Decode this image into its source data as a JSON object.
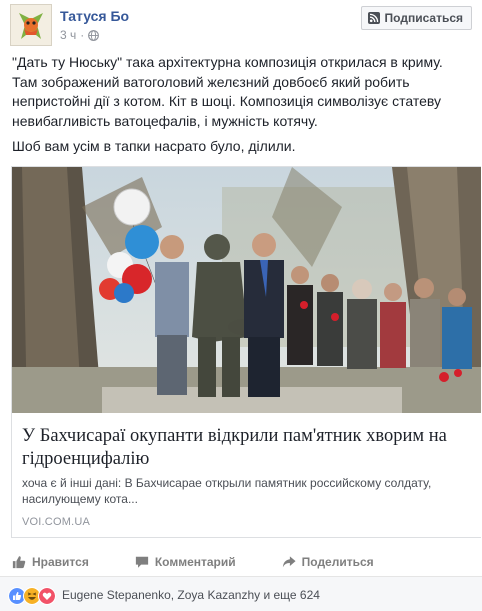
{
  "header": {
    "author_name": "Татуся Бо",
    "timestamp": "3 ч",
    "privacy_icon": "globe-icon",
    "subscribe_label": "Подписаться"
  },
  "post": {
    "paragraph_1": "\"Дать ту Нюську\" така архітектурна композиція открилася в криму. Там зображений ватоголовий желєзний довбоєб який робить непристойні дії з котом. Кіт в шоці. Композиція символізує статеву невибагливість ватоцефалів, і мужність котячу.",
    "paragraph_2": "Шоб вам усім в тапки насрато було, ділили."
  },
  "link_card": {
    "title": "У Бахчисараї окупанти відкрили пам'ятник хворим на гідроенцифалію",
    "description": "хоча є й інші дані: В Бахчисарае открыли памятник российскому солдату, насилующему кота...",
    "domain": "VOI.COM.UA"
  },
  "actions": {
    "like": "Нравится",
    "comment": "Комментарий",
    "share": "Поделиться"
  },
  "reactions": {
    "summary": "Eugene Stepanenko, Zoya Kazanzhy и еще 624",
    "icons": [
      "like-reaction-icon",
      "haha-reaction-icon",
      "love-reaction-icon"
    ],
    "colors": {
      "like": "#5890ff",
      "haha": "#f7b125",
      "love": "#f25268"
    }
  },
  "colors": {
    "link_blue": "#365899",
    "meta_gray": "#90949c"
  }
}
